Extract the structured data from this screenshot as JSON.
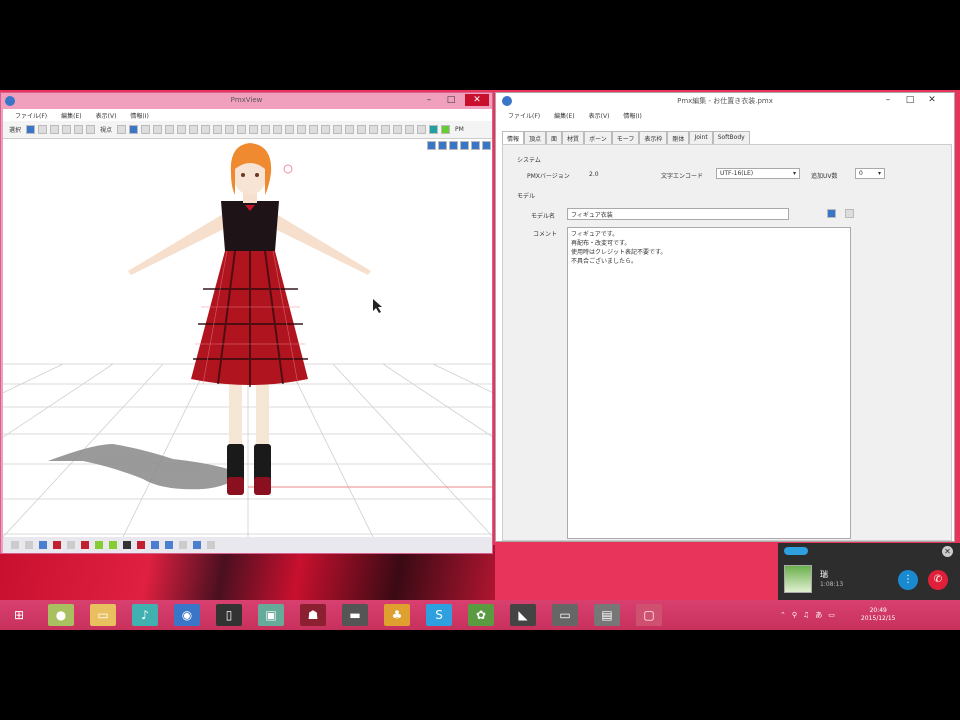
{
  "pmx_window": {
    "title": "PmxView",
    "menu": [
      "ファイル(F)",
      "編集(E)",
      "表示(V)",
      "情報(I)"
    ],
    "toolbar_labels": [
      "選択",
      "視点"
    ],
    "right_tool": "PM"
  },
  "editor_window": {
    "title": "Pmx編集 - お仕置き衣装.pmx",
    "menu": [
      "ファイル(F)",
      "編集(E)",
      "表示(V)",
      "情報(I)"
    ],
    "tabs": [
      "情報",
      "頂点",
      "面",
      "材質",
      "ボーン",
      "モーフ",
      "表示枠",
      "剛体",
      "Joint",
      "SoftBody"
    ],
    "system_label": "システム",
    "pmx_version_label": "PMXバージョン",
    "pmx_version_value": "2.0",
    "encoding_label": "文字エンコード",
    "encoding_value": "UTF-16(LE)",
    "extra_uv_label": "追加UV数",
    "extra_uv_value": "0",
    "model_section_label": "モデル",
    "model_name_label": "モデル名",
    "model_name_value": "フィギュア衣装",
    "comment_label": "コメント",
    "comment_lines": [
      "フィギュアです。",
      "再配布・改変可です。",
      "使用時はクレジット表記不要です。",
      "不具合ございましたら。"
    ]
  },
  "skype": {
    "contact_name": "瑞",
    "call_duration": "1:08:13"
  },
  "tray": {
    "time": "20:49",
    "date": "2015/12/15"
  },
  "colors": {
    "desktop": "#e8335a",
    "pmx_frame": "#f0a0bc",
    "taskbar": "#c8305c",
    "skype_bg": "#2d2d2d",
    "call_green": "#1a8ad0",
    "hangup_red": "#e0203a"
  }
}
